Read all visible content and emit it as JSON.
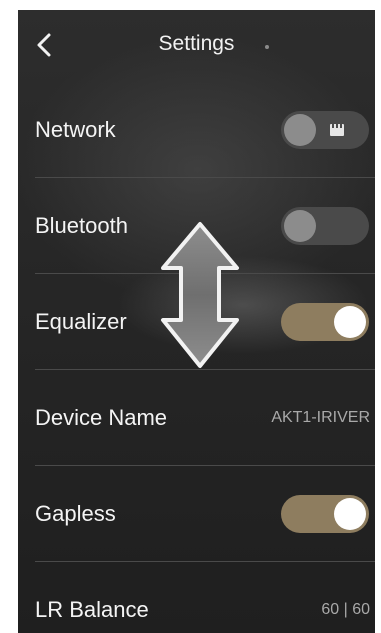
{
  "header": {
    "title": "Settings",
    "back_icon": "chevron-left-icon"
  },
  "settings": [
    {
      "label": "Network",
      "control": "toggle",
      "on": false,
      "icon": "ethernet-icon"
    },
    {
      "label": "Bluetooth",
      "control": "toggle",
      "on": false
    },
    {
      "label": "Equalizer",
      "control": "toggle",
      "on": true
    },
    {
      "label": "Device Name",
      "control": "value",
      "value": "AKT1-IRIVER"
    },
    {
      "label": "Gapless",
      "control": "toggle",
      "on": true
    },
    {
      "label": "LR Balance",
      "control": "value",
      "value": "60 | 60"
    }
  ],
  "overlay": {
    "icon": "vertical-scroll-arrow-icon"
  },
  "colors": {
    "toggle_on": "#8e7d5f",
    "toggle_off": "#4a4a4a",
    "background": "#262626"
  }
}
